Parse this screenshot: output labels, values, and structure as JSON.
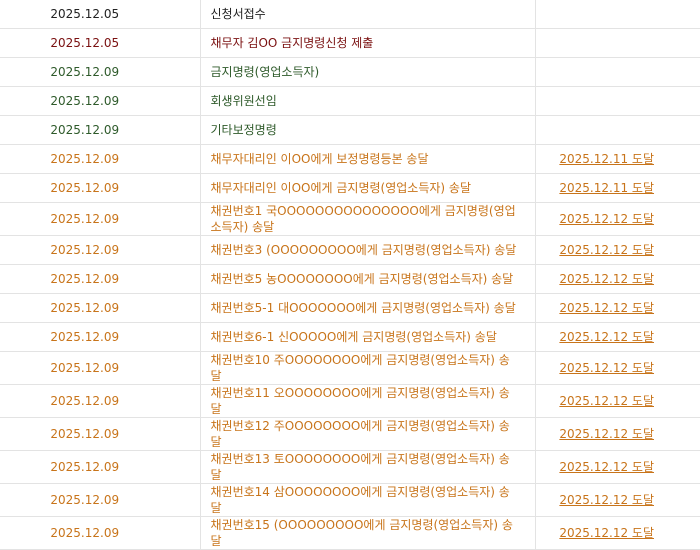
{
  "colors": {
    "black": "#222222",
    "red": "#7a1010",
    "green": "#2e5a2a",
    "orange": "#c8741a"
  },
  "rows": [
    {
      "date": "2025.12.05",
      "content": "신청서접수",
      "result": "",
      "color": "black"
    },
    {
      "date": "2025.12.05",
      "content": "채무자 김OO 금지명령신청 제출",
      "result": "",
      "color": "red"
    },
    {
      "date": "2025.12.09",
      "content": "금지명령(영업소득자)",
      "result": "",
      "color": "green"
    },
    {
      "date": "2025.12.09",
      "content": "회생위원선임",
      "result": "",
      "color": "green"
    },
    {
      "date": "2025.12.09",
      "content": "기타보정명령",
      "result": "",
      "color": "green"
    },
    {
      "date": "2025.12.09",
      "content": "채무자대리인 이OO에게 보정명령등본 송달",
      "result": "2025.12.11 도달",
      "color": "orange"
    },
    {
      "date": "2025.12.09",
      "content": "채무자대리인 이OO에게 금지명령(영업소득자) 송달",
      "result": "2025.12.11 도달",
      "color": "orange"
    },
    {
      "date": "2025.12.09",
      "content": "채권번호1 국OOOOOOOOOOOOOOO에게 금지명령(영업소득자) 송달",
      "result": "2025.12.12 도달",
      "color": "orange"
    },
    {
      "date": "2025.12.09",
      "content": "채권번호3 (OOOOOOOOO에게 금지명령(영업소득자) 송달",
      "result": "2025.12.12 도달",
      "color": "orange"
    },
    {
      "date": "2025.12.09",
      "content": "채권번호5 농OOOOOOOO에게 금지명령(영업소득자) 송달",
      "result": "2025.12.12 도달",
      "color": "orange"
    },
    {
      "date": "2025.12.09",
      "content": "채권번호5-1 대OOOOOOO에게 금지명령(영업소득자) 송달",
      "result": "2025.12.12 도달",
      "color": "orange"
    },
    {
      "date": "2025.12.09",
      "content": "채권번호6-1 신OOOOO에게 금지명령(영업소득자) 송달",
      "result": "2025.12.12 도달",
      "color": "orange"
    },
    {
      "date": "2025.12.09",
      "content": "채권번호10 주OOOOOOOO에게 금지명령(영업소득자) 송달",
      "result": "2025.12.12 도달",
      "color": "orange"
    },
    {
      "date": "2025.12.09",
      "content": "채권번호11 오OOOOOOOO에게 금지명령(영업소득자) 송달",
      "result": "2025.12.12 도달",
      "color": "orange"
    },
    {
      "date": "2025.12.09",
      "content": "채권번호12 주OOOOOOOO에게 금지명령(영업소득자) 송달",
      "result": "2025.12.12 도달",
      "color": "orange"
    },
    {
      "date": "2025.12.09",
      "content": "채권번호13 토OOOOOOOO에게 금지명령(영업소득자) 송달",
      "result": "2025.12.12 도달",
      "color": "orange"
    },
    {
      "date": "2025.12.09",
      "content": "채권번호14 삼OOOOOOOO에게 금지명령(영업소득자) 송달",
      "result": "2025.12.12 도달",
      "color": "orange"
    },
    {
      "date": "2025.12.09",
      "content": "채권번호15 (OOOOOOOOO에게 금지명령(영업소득자) 송달",
      "result": "2025.12.12 도달",
      "color": "orange"
    }
  ]
}
